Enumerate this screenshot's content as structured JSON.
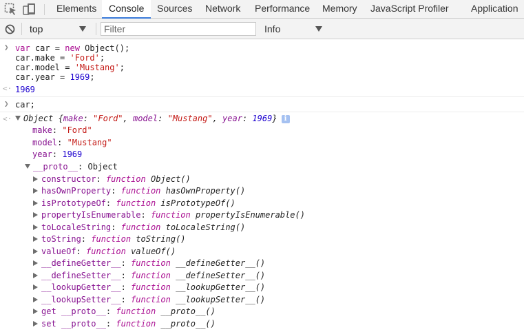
{
  "tabs": [
    "Elements",
    "Console",
    "Sources",
    "Network",
    "Performance",
    "Memory",
    "JavaScript Profiler",
    "Application"
  ],
  "active_tab": "Console",
  "toolbar": {
    "context": "top",
    "filter_placeholder": "Filter",
    "level": "Info"
  },
  "console": {
    "input1": [
      "var car = new Object();",
      "car.make = 'Ford';",
      "car.model = 'Mustang';",
      "car.year = 1969;"
    ],
    "result1": "1969",
    "input2": "car;",
    "object_preview": {
      "label": "Object",
      "make_key": "make",
      "make_val": "\"Ford\"",
      "model_key": "model",
      "model_val": "\"Mustang\"",
      "year_key": "year",
      "year_val": "1969"
    },
    "props": [
      {
        "key": "make",
        "value": "\"Ford\""
      },
      {
        "key": "model",
        "value": "\"Mustang\""
      },
      {
        "key": "year",
        "value": "1969"
      }
    ],
    "proto": {
      "key": "__proto__",
      "value": "Object"
    },
    "proto_members": [
      {
        "key": "constructor",
        "fn": "Object()"
      },
      {
        "key": "hasOwnProperty",
        "fn": "hasOwnProperty()"
      },
      {
        "key": "isPrototypeOf",
        "fn": "isPrototypeOf()"
      },
      {
        "key": "propertyIsEnumerable",
        "fn": "propertyIsEnumerable()"
      },
      {
        "key": "toLocaleString",
        "fn": "toLocaleString()"
      },
      {
        "key": "toString",
        "fn": "toString()"
      },
      {
        "key": "valueOf",
        "fn": "valueOf()"
      },
      {
        "key": "__defineGetter__",
        "fn": "__defineGetter__()"
      },
      {
        "key": "__defineSetter__",
        "fn": "__defineSetter__()"
      },
      {
        "key": "__lookupGetter__",
        "fn": "__lookupGetter__()"
      },
      {
        "key": "__lookupSetter__",
        "fn": "__lookupSetter__()"
      },
      {
        "key": "get __proto__",
        "fn": "__proto__()"
      },
      {
        "key": "set __proto__",
        "fn": "__proto__()"
      }
    ],
    "function_keyword": "function"
  },
  "colors": {
    "accent": "#3879d9",
    "keyword": "#aa0d91",
    "string": "#c41a16",
    "number": "#1c00cf",
    "property": "#881391"
  },
  "icons": [
    "inspect-element-icon",
    "device-toggle-icon",
    "clear-console-icon",
    "info-icon"
  ]
}
